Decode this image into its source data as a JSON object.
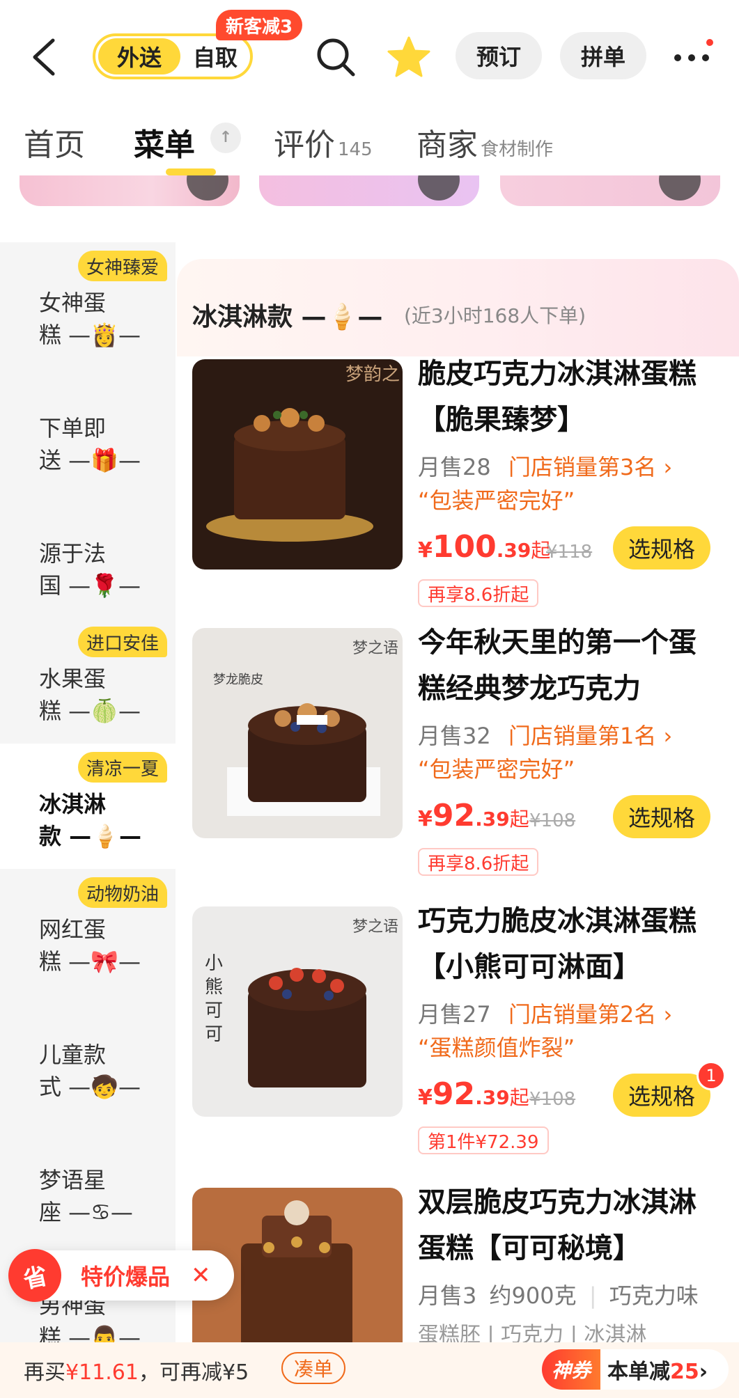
{
  "header": {
    "mode_on": "外送",
    "mode_off": "自取",
    "promo_tag": "新客减3",
    "reserve_label": "预订",
    "group_label": "拼单"
  },
  "tabs": {
    "home": "首页",
    "menu": "菜单",
    "menu_pin": "↑",
    "reviews": "评价",
    "reviews_count": "145",
    "merchant": "商家",
    "merchant_sub": "食材制作"
  },
  "sidebar": {
    "items": [
      {
        "name": "女神蛋糕 —👸—",
        "badge": "女神臻爱"
      },
      {
        "name": "下单即送 —🎁—",
        "badge": ""
      },
      {
        "name": "源于法国 —🌹—",
        "badge": ""
      },
      {
        "name": "水果蛋糕 —🍈—",
        "badge": "进口安佳"
      },
      {
        "name": "冰淇淋款 —🍦—",
        "badge": "清凉一夏",
        "active": true
      },
      {
        "name": "网红蛋糕 —🎀—",
        "badge": "动物奶油"
      },
      {
        "name": "儿童款式 —🧒—",
        "badge": ""
      },
      {
        "name": "梦语星座 —♋—",
        "badge": ""
      },
      {
        "name": "男神蛋糕 —👨—",
        "badge": ""
      }
    ]
  },
  "section": {
    "title": "冰淇淋款 —🍦—",
    "subtitle": "(近3小时168人下单)"
  },
  "products": [
    {
      "name": "脆皮巧克力冰淇淋蛋糕【脆果臻梦】",
      "sales": "月售28",
      "rank": "门店销量第3名 ›",
      "review": "“包装严密完好”",
      "price_int": "100",
      "price_dec": ".39",
      "price_from": "起",
      "orig": "¥118",
      "deal": "再享8.6折起",
      "spec": "选规格"
    },
    {
      "name": "今年秋天里的第一个蛋糕经典梦龙巧克力",
      "sales": "月售32",
      "rank": "门店销量第1名 ›",
      "review": "“包装严密完好”",
      "price_int": "92",
      "price_dec": ".39",
      "price_from": "起",
      "orig": "¥108",
      "deal": "再享8.6折起",
      "spec": "选规格"
    },
    {
      "name": "巧克力脆皮冰淇淋蛋糕【小熊可可淋面】",
      "sales": "月售27",
      "rank": "门店销量第2名 ›",
      "review": "“蛋糕颜值炸裂”",
      "price_int": "92",
      "price_dec": ".39",
      "price_from": "起",
      "orig": "¥108",
      "deal": "第1件¥72.39",
      "spec": "选规格",
      "count": "1"
    },
    {
      "name": "双层脆皮巧克力冰淇淋蛋糕【可可秘境】",
      "sales": "月售3",
      "weight": "约900克",
      "flavor": "巧克力味",
      "meta2": "蛋糕胚 | 巧克力 | 冰淇淋"
    }
  ],
  "float_offer": {
    "logo": "省",
    "label": "特价爆品",
    "close": "✕"
  },
  "cart": {
    "info_prefix": "再买",
    "info_amount": "¥11.61",
    "info_suffix": "，可再减¥5",
    "addon": "凑单",
    "coupon_tag": "神券",
    "coupon_text": "本单减",
    "coupon_amount": "25",
    "coupon_arrow": "›"
  },
  "colors": {
    "accent_yellow": "#ffd83a",
    "price_red": "#ff3b30",
    "rank_orange": "#f06a1b"
  }
}
